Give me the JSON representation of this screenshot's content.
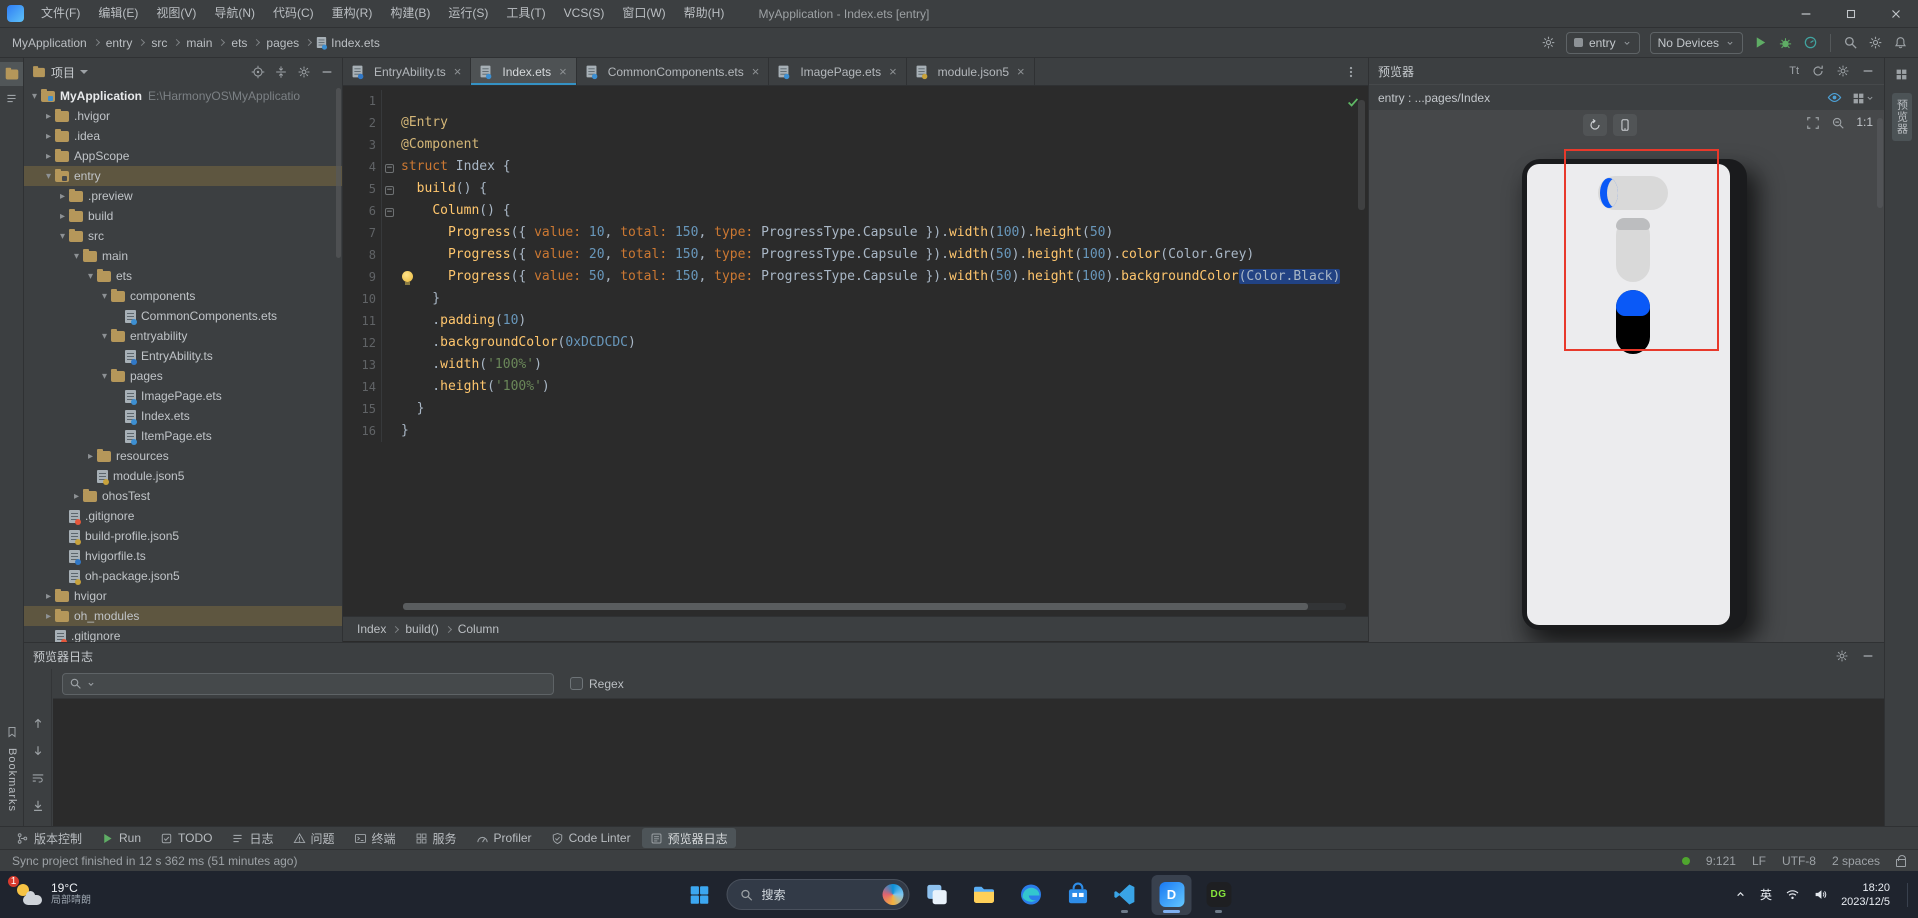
{
  "theme": {
    "accent": "#3592c4",
    "run_green": "#5fad65",
    "error_red": "#e8392b",
    "progress_blue": "#0a59f7",
    "selection_olive": "#5e5640"
  },
  "titlebar": {
    "title": "MyApplication - Index.ets [entry]",
    "menus": [
      "文件(F)",
      "编辑(E)",
      "视图(V)",
      "导航(N)",
      "代码(C)",
      "重构(R)",
      "构建(B)",
      "运行(S)",
      "工具(T)",
      "VCS(S)",
      "窗口(W)",
      "帮助(H)"
    ]
  },
  "navbar": {
    "breadcrumbs": [
      "MyApplication",
      "entry",
      "src",
      "main",
      "ets",
      "pages",
      "Index.ets"
    ],
    "module_selector": "entry",
    "device_selector": "No Devices"
  },
  "left_strip": {
    "bookmarks_label": "Bookmarks"
  },
  "right_strip": {
    "tab_label": "预览器"
  },
  "project": {
    "title": "项目",
    "items": [
      {
        "label": "MyApplication",
        "suffix": "E:\\HarmonyOS\\MyApplicatio",
        "level": 0,
        "kind": "project",
        "state": "expanded",
        "bold": true
      },
      {
        "label": ".hvigor",
        "level": 1,
        "kind": "folder",
        "state": "collapsed"
      },
      {
        "label": ".idea",
        "level": 1,
        "kind": "folder",
        "state": "collapsed"
      },
      {
        "label": "AppScope",
        "level": 1,
        "kind": "folder",
        "state": "collapsed"
      },
      {
        "label": "entry",
        "level": 1,
        "kind": "module",
        "state": "expanded",
        "highlight": true
      },
      {
        "label": ".preview",
        "level": 2,
        "kind": "folder",
        "state": "collapsed"
      },
      {
        "label": "build",
        "level": 2,
        "kind": "folder",
        "state": "collapsed"
      },
      {
        "label": "src",
        "level": 2,
        "kind": "folder",
        "state": "expanded"
      },
      {
        "label": "main",
        "level": 3,
        "kind": "folder",
        "state": "expanded"
      },
      {
        "label": "ets",
        "level": 4,
        "kind": "folder",
        "state": "expanded"
      },
      {
        "label": "components",
        "level": 5,
        "kind": "folder",
        "state": "expanded"
      },
      {
        "label": "CommonComponents.ets",
        "level": 6,
        "kind": "ets"
      },
      {
        "label": "entryability",
        "level": 5,
        "kind": "folder",
        "state": "expanded"
      },
      {
        "label": "EntryAbility.ts",
        "level": 6,
        "kind": "ts"
      },
      {
        "label": "pages",
        "level": 5,
        "kind": "folder",
        "state": "expanded"
      },
      {
        "label": "ImagePage.ets",
        "level": 6,
        "kind": "ets"
      },
      {
        "label": "Index.ets",
        "level": 6,
        "kind": "ets"
      },
      {
        "label": "ItemPage.ets",
        "level": 6,
        "kind": "ets"
      },
      {
        "label": "resources",
        "level": 4,
        "kind": "folder",
        "state": "collapsed"
      },
      {
        "label": "module.json5",
        "level": 4,
        "kind": "json"
      },
      {
        "label": "ohosTest",
        "level": 3,
        "kind": "folder",
        "state": "collapsed"
      },
      {
        "label": ".gitignore",
        "level": 2,
        "kind": "git"
      },
      {
        "label": "build-profile.json5",
        "level": 2,
        "kind": "json"
      },
      {
        "label": "hvigorfile.ts",
        "level": 2,
        "kind": "ts"
      },
      {
        "label": "oh-package.json5",
        "level": 2,
        "kind": "json"
      },
      {
        "label": "hvigor",
        "level": 1,
        "kind": "folder",
        "state": "collapsed"
      },
      {
        "label": "oh_modules",
        "level": 1,
        "kind": "folder",
        "state": "collapsed",
        "highlight": true
      },
      {
        "label": ".gitignore",
        "level": 1,
        "kind": "git"
      }
    ]
  },
  "editor": {
    "tabs": [
      {
        "label": "EntryAbility.ts",
        "kind": "ts",
        "active": false
      },
      {
        "label": "Index.ets",
        "kind": "ets",
        "active": true
      },
      {
        "label": "CommonComponents.ets",
        "kind": "ets",
        "active": false
      },
      {
        "label": "ImagePage.ets",
        "kind": "ets",
        "active": false
      },
      {
        "label": "module.json5",
        "kind": "json",
        "active": false
      }
    ],
    "fold_lines": [
      4,
      5,
      6
    ],
    "bulb_line": 9,
    "breadcrumb": [
      "Index",
      "build()",
      "Column"
    ],
    "lines": [
      [],
      [
        [
          "ann",
          "@Entry"
        ]
      ],
      [
        [
          "ann",
          "@Component"
        ]
      ],
      [
        [
          "kw",
          "struct"
        ],
        [
          "pl",
          " Index {"
        ]
      ],
      [
        [
          "pl",
          "  "
        ],
        [
          "fn",
          "build"
        ],
        [
          "pl",
          "() {"
        ]
      ],
      [
        [
          "pl",
          "    "
        ],
        [
          "fn",
          "Column"
        ],
        [
          "pl",
          "() {"
        ]
      ],
      [
        [
          "pl",
          "      "
        ],
        [
          "fn",
          "Progress"
        ],
        [
          "pl",
          "({ "
        ],
        [
          "prop",
          "value:"
        ],
        [
          "pl",
          " "
        ],
        [
          "num",
          "10"
        ],
        [
          "pl",
          ", "
        ],
        [
          "prop",
          "total:"
        ],
        [
          "pl",
          " "
        ],
        [
          "num",
          "150"
        ],
        [
          "pl",
          ", "
        ],
        [
          "prop",
          "type:"
        ],
        [
          "pl",
          " ProgressType.Capsule })."
        ],
        [
          "fn",
          "width"
        ],
        [
          "pl",
          "("
        ],
        [
          "num",
          "100"
        ],
        [
          "pl",
          ")."
        ],
        [
          "fn",
          "height"
        ],
        [
          "pl",
          "("
        ],
        [
          "num",
          "50"
        ],
        [
          "pl",
          ")"
        ]
      ],
      [
        [
          "pl",
          "      "
        ],
        [
          "fn",
          "Progress"
        ],
        [
          "pl",
          "({ "
        ],
        [
          "prop",
          "value:"
        ],
        [
          "pl",
          " "
        ],
        [
          "num",
          "20"
        ],
        [
          "pl",
          ", "
        ],
        [
          "prop",
          "total:"
        ],
        [
          "pl",
          " "
        ],
        [
          "num",
          "150"
        ],
        [
          "pl",
          ", "
        ],
        [
          "prop",
          "type:"
        ],
        [
          "pl",
          " ProgressType.Capsule })."
        ],
        [
          "fn",
          "width"
        ],
        [
          "pl",
          "("
        ],
        [
          "num",
          "50"
        ],
        [
          "pl",
          ")."
        ],
        [
          "fn",
          "height"
        ],
        [
          "pl",
          "("
        ],
        [
          "num",
          "100"
        ],
        [
          "pl",
          ")."
        ],
        [
          "fn",
          "color"
        ],
        [
          "pl",
          "(Color.Grey)"
        ]
      ],
      [
        [
          "pl",
          "      "
        ],
        [
          "fn",
          "Progress"
        ],
        [
          "pl",
          "({ "
        ],
        [
          "prop",
          "value:"
        ],
        [
          "pl",
          " "
        ],
        [
          "num",
          "50"
        ],
        [
          "pl",
          ", "
        ],
        [
          "prop",
          "total:"
        ],
        [
          "pl",
          " "
        ],
        [
          "num",
          "150"
        ],
        [
          "pl",
          ", "
        ],
        [
          "prop",
          "type:"
        ],
        [
          "pl",
          " ProgressType.Capsule })."
        ],
        [
          "fn",
          "width"
        ],
        [
          "pl",
          "("
        ],
        [
          "num",
          "50"
        ],
        [
          "pl",
          ")."
        ],
        [
          "fn",
          "height"
        ],
        [
          "pl",
          "("
        ],
        [
          "num",
          "100"
        ],
        [
          "pl",
          ")."
        ],
        [
          "fn",
          "backgroundColor"
        ],
        [
          "sel",
          "(Color.Black)"
        ]
      ],
      [
        [
          "pl",
          "    }"
        ]
      ],
      [
        [
          "pl",
          "    ."
        ],
        [
          "fn",
          "padding"
        ],
        [
          "pl",
          "("
        ],
        [
          "num",
          "10"
        ],
        [
          "pl",
          ")"
        ]
      ],
      [
        [
          "pl",
          "    ."
        ],
        [
          "fn",
          "backgroundColor"
        ],
        [
          "pl",
          "("
        ],
        [
          "num",
          "0xDCDCDC"
        ],
        [
          "pl",
          ")"
        ]
      ],
      [
        [
          "pl",
          "    ."
        ],
        [
          "fn",
          "width"
        ],
        [
          "pl",
          "("
        ],
        [
          "str",
          "'100%'"
        ],
        [
          "pl",
          ")"
        ]
      ],
      [
        [
          "pl",
          "    ."
        ],
        [
          "fn",
          "height"
        ],
        [
          "pl",
          "("
        ],
        [
          "str",
          "'100%'"
        ],
        [
          "pl",
          ")"
        ]
      ],
      [
        [
          "pl",
          "  }"
        ]
      ],
      [
        [
          "pl",
          "}"
        ]
      ]
    ]
  },
  "previewer": {
    "title": "预览器",
    "target": "entry : ...pages/Index",
    "font_label": "Tt",
    "zoom_label": "1:1"
  },
  "log_panel": {
    "title": "预览器日志",
    "regex_label": "Regex",
    "search_value": ""
  },
  "bottom_bar": {
    "items": [
      {
        "label": "版本控制",
        "icon": "branch"
      },
      {
        "label": "Run",
        "icon": "play"
      },
      {
        "label": "TODO",
        "icon": "todoi"
      },
      {
        "label": "日志",
        "icon": "loglist"
      },
      {
        "label": "问题",
        "icon": "problems"
      },
      {
        "label": "终端",
        "icon": "terminal"
      },
      {
        "label": "服务",
        "icon": "services"
      },
      {
        "label": "Profiler",
        "icon": "profiler"
      },
      {
        "label": "Code Linter",
        "icon": "linter"
      },
      {
        "label": "预览器日志",
        "icon": "previewlog",
        "active": true
      }
    ]
  },
  "statusbar": {
    "message": "Sync project finished in 12 s 362 ms (51 minutes ago)",
    "caret": "9:121",
    "line_ending": "LF",
    "encoding": "UTF-8",
    "indent": "2 spaces"
  },
  "taskbar": {
    "weather": {
      "temp": "19°C",
      "desc": "局部晴朗",
      "badge": "1"
    },
    "search_label": "搜索",
    "apps": [
      {
        "name": "task-view"
      },
      {
        "name": "file-explorer"
      },
      {
        "name": "edge"
      },
      {
        "name": "store"
      },
      {
        "name": "vscode",
        "running": true
      },
      {
        "name": "deveco",
        "label": "D",
        "active": true,
        "running": true
      },
      {
        "name": "datagrip",
        "label": "DG",
        "running": true
      }
    ],
    "ime": "英",
    "time": "18:20",
    "date": "2023/12/5"
  }
}
